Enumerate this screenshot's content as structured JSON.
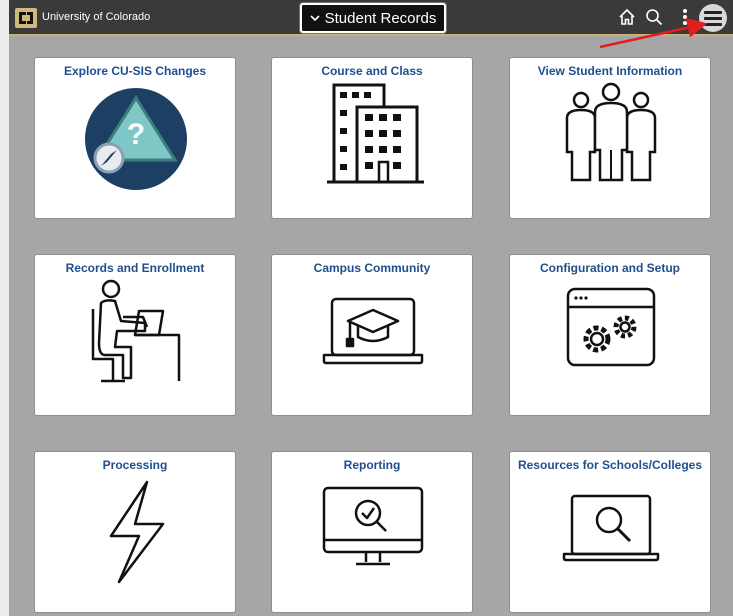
{
  "header": {
    "brand": "University of Colorado",
    "title": "Student Records",
    "accent_color": "#cfb87c",
    "icons": [
      "chevron-down-icon",
      "home-icon",
      "search-icon",
      "more-vertical-icon",
      "hamburger-menu-icon"
    ]
  },
  "tiles": [
    {
      "label": "Explore CU-SIS Changes",
      "icon": "compass-question-icon"
    },
    {
      "label": "Course and Class",
      "icon": "buildings-icon"
    },
    {
      "label": "View Student Information",
      "icon": "people-group-icon"
    },
    {
      "label": "Records and Enrollment",
      "icon": "person-at-desk-icon"
    },
    {
      "label": "Campus Community",
      "icon": "laptop-graduation-cap-icon"
    },
    {
      "label": "Configuration and Setup",
      "icon": "browser-gears-icon"
    },
    {
      "label": "Processing",
      "icon": "lightning-bolt-icon"
    },
    {
      "label": "Reporting",
      "icon": "monitor-search-icon"
    },
    {
      "label": "Resources for Schools/Colleges",
      "icon": "laptop-search-icon"
    }
  ],
  "annotation": {
    "arrow_color": "#e02020"
  }
}
